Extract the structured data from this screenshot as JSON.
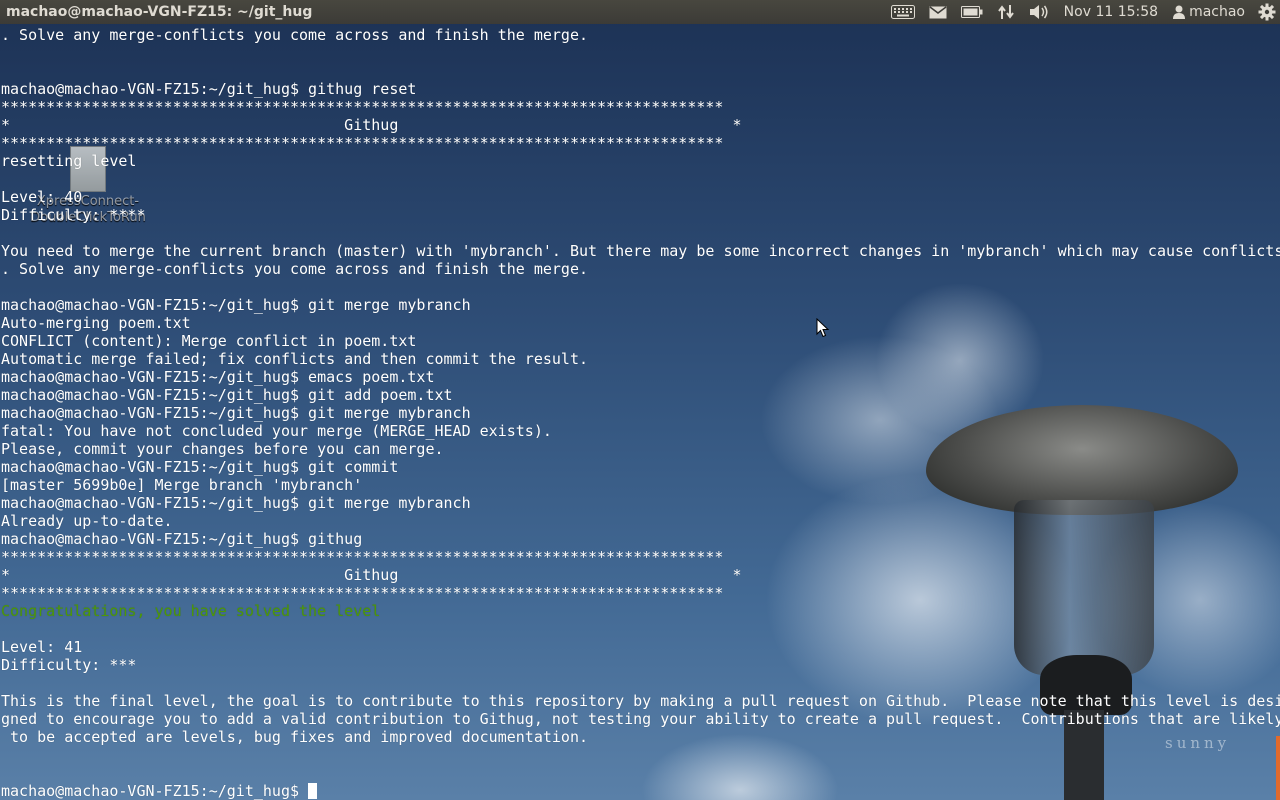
{
  "window_title": "machao@machao-VGN-FZ15: ~/git_hug",
  "panel": {
    "icons": [
      "keyboard-icon",
      "mail-icon",
      "battery-icon",
      "network-icon",
      "volume-icon",
      "user-icon",
      "gear-icon"
    ],
    "clock": "Nov 11 15:58",
    "user": "machao"
  },
  "desktop_icon": {
    "icon": "document-icon",
    "label_line1": "XpressConnect-",
    "label_line2": "DoubleClickToRun"
  },
  "wallpaper": {
    "watermark": "sunny"
  },
  "colors": {
    "terminal_text": "#ffffff",
    "success_text": "#4e9a06",
    "panel_bg": "#3c3b37"
  },
  "terminal": {
    "lines": [
      ". Solve any merge-conflicts you come across and finish the merge.",
      "",
      "",
      "machao@machao-VGN-FZ15:~/git_hug$ githug reset",
      "********************************************************************************",
      "*                                     Githug                                     *",
      "********************************************************************************",
      "resetting level",
      "",
      "Level: 40",
      "Difficulty: ****",
      "",
      "You need to merge the current branch (master) with 'mybranch'. But there may be some incorrect changes in 'mybranch' which may cause conflicts",
      ". Solve any merge-conflicts you come across and finish the merge.",
      "",
      "machao@machao-VGN-FZ15:~/git_hug$ git merge mybranch",
      "Auto-merging poem.txt",
      "CONFLICT (content): Merge conflict in poem.txt",
      "Automatic merge failed; fix conflicts and then commit the result.",
      "machao@machao-VGN-FZ15:~/git_hug$ emacs poem.txt",
      "machao@machao-VGN-FZ15:~/git_hug$ git add poem.txt",
      "machao@machao-VGN-FZ15:~/git_hug$ git merge mybranch",
      "fatal: You have not concluded your merge (MERGE_HEAD exists).",
      "Please, commit your changes before you can merge.",
      "machao@machao-VGN-FZ15:~/git_hug$ git commit",
      "[master 5699b0e] Merge branch 'mybranch'",
      "machao@machao-VGN-FZ15:~/git_hug$ git merge mybranch",
      "Already up-to-date.",
      "machao@machao-VGN-FZ15:~/git_hug$ githug",
      "********************************************************************************",
      "*                                     Githug                                     *",
      "********************************************************************************",
      "Congratulations, you have solved the level",
      "",
      "Level: 41",
      "Difficulty: ***",
      "",
      "This is the final level, the goal is to contribute to this repository by making a pull request on Github.  Please note that this level is desi",
      "gned to encourage you to add a valid contribution to Githug, not testing your ability to create a pull request.  Contributions that are likely",
      " to be accepted are levels, bug fixes and improved documentation.",
      "",
      ""
    ],
    "prompt": "machao@machao-VGN-FZ15:~/git_hug$ "
  }
}
